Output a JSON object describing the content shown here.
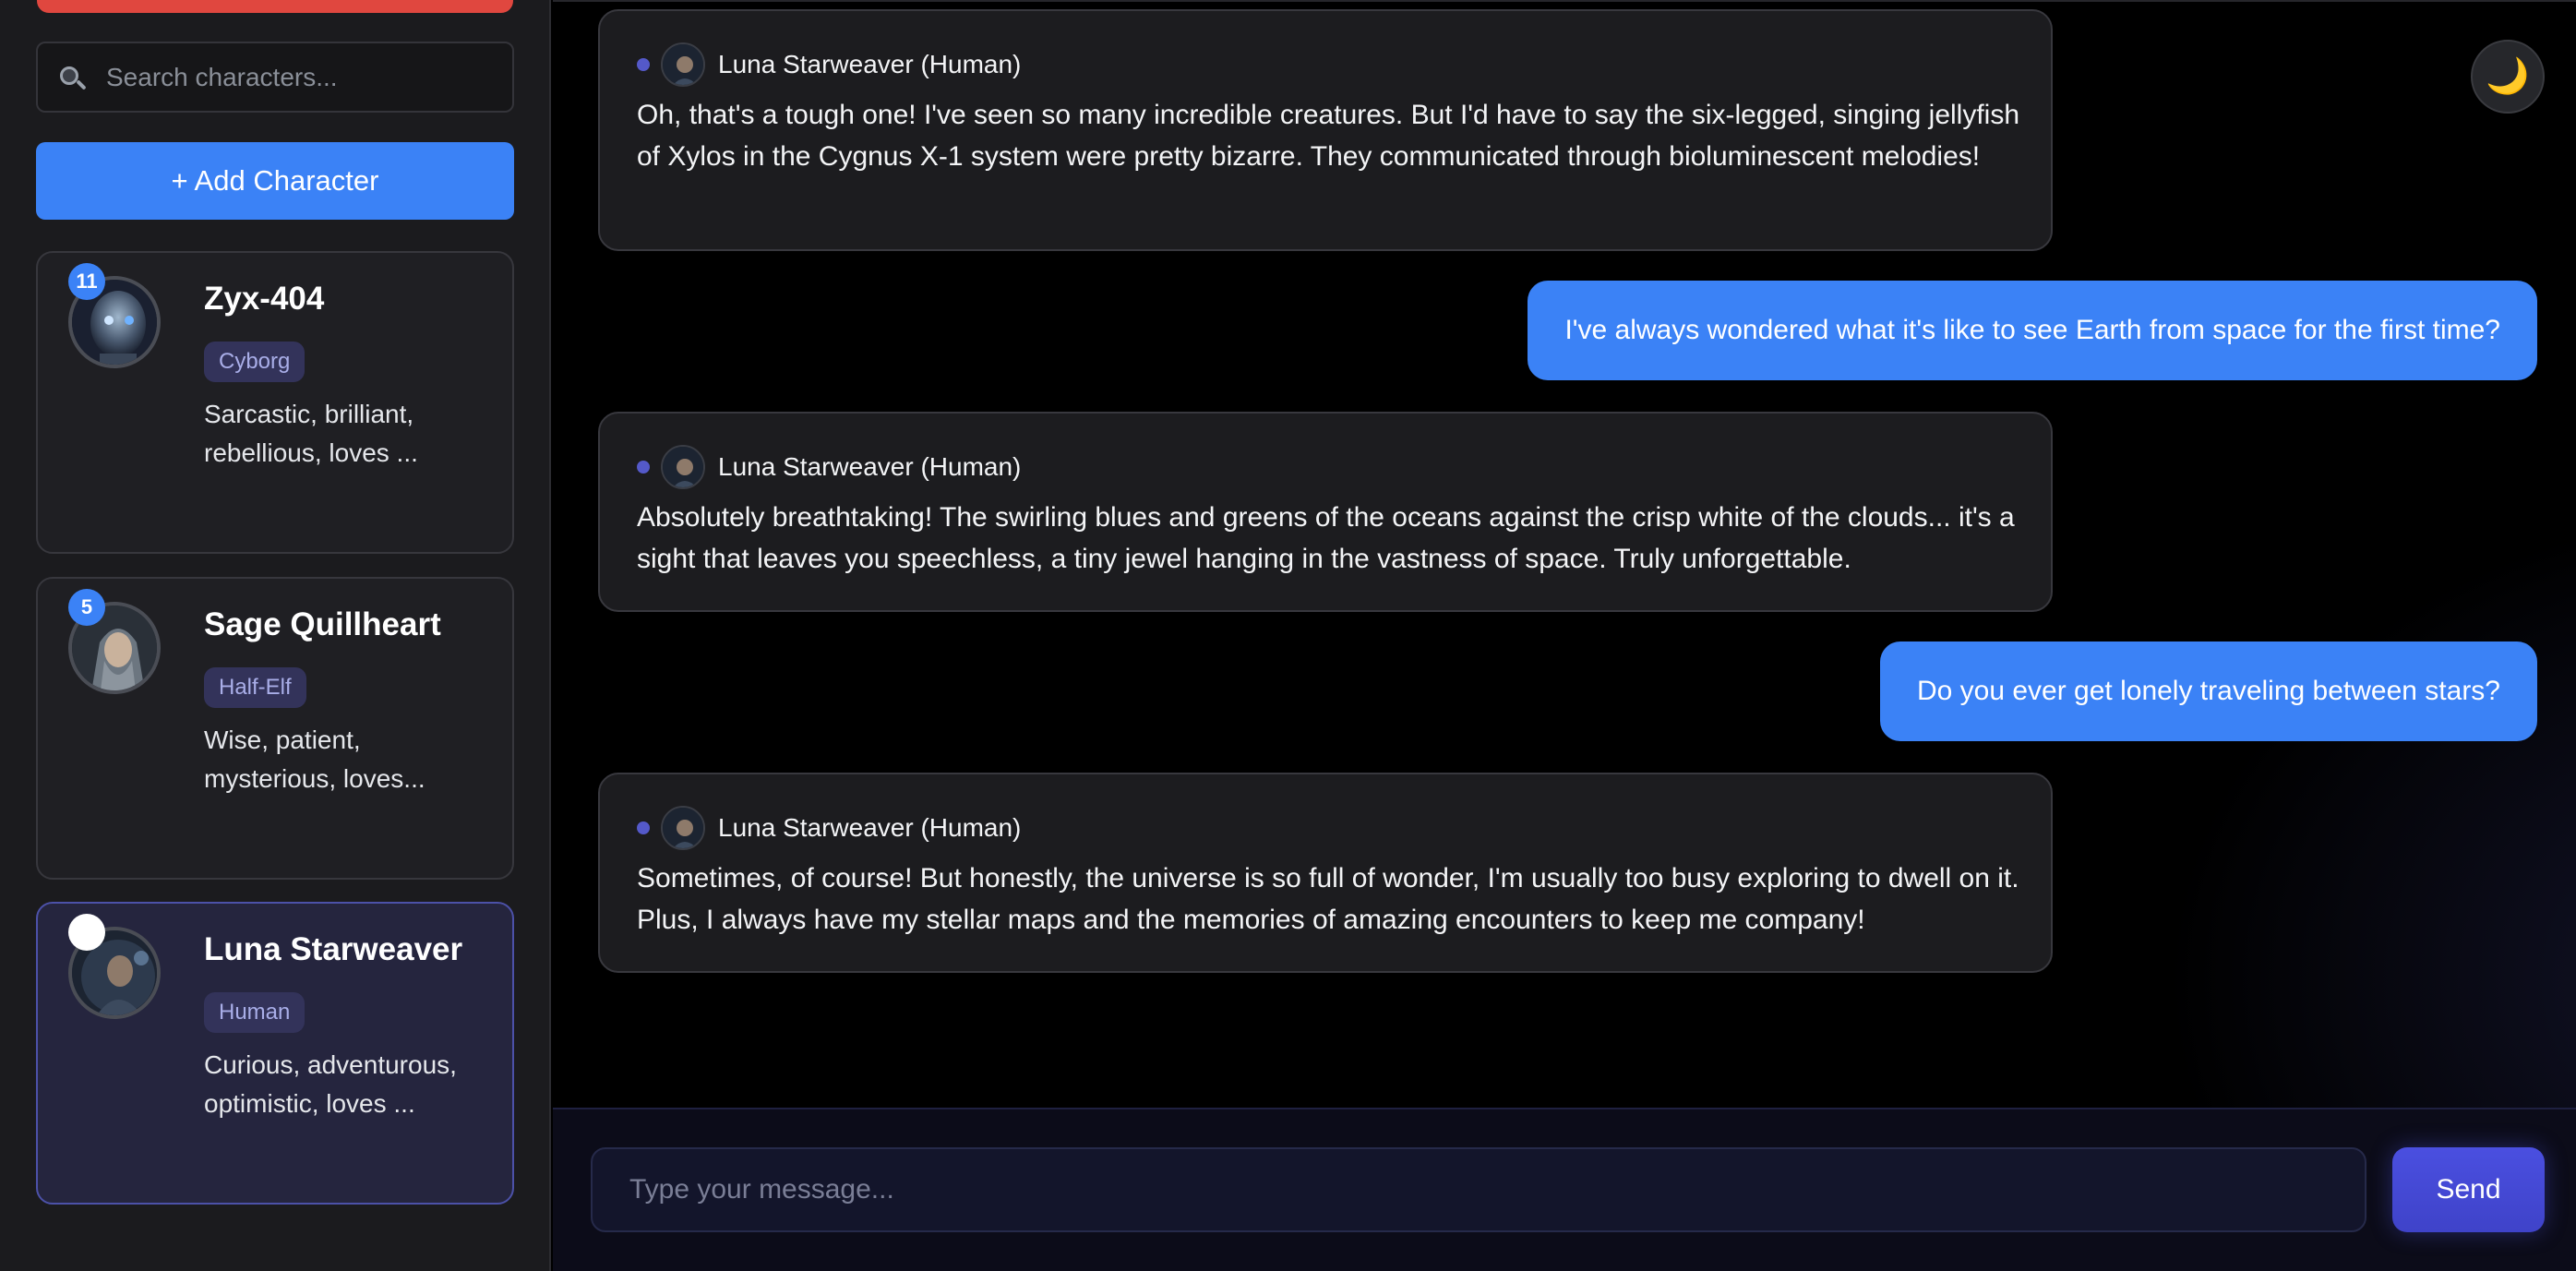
{
  "search": {
    "placeholder": "Search characters..."
  },
  "add_character": {
    "label": "+ Add Character"
  },
  "characters": [
    {
      "name": "Zyx-404",
      "race": "Cyborg",
      "description": "Sarcastic, brilliant, rebellious, loves ...",
      "badge": "11",
      "selected": false,
      "avatar_icon": "cyborg-portrait"
    },
    {
      "name": "Sage Quillheart",
      "race": "Half-Elf",
      "description": "Wise, patient, mysterious, loves...",
      "badge": "5",
      "selected": false,
      "avatar_icon": "half-elf-portrait"
    },
    {
      "name": "Luna Starweaver",
      "race": "Human",
      "description": "Curious, adventurous, optimistic, loves ...",
      "badge": "",
      "selected": true,
      "avatar_icon": "human-portrait"
    }
  ],
  "messages": [
    {
      "role": "ai",
      "author": "Luna Starweaver (Human)",
      "text": "Oh, that's a tough one! I've seen so many incredible creatures. But I'd have to say the six-legged, singing jellyfish of Xylos in the Cygnus X-1 system were pretty bizarre. They communicated through bioluminescent melodies!"
    },
    {
      "role": "user",
      "text": "I've always wondered what it's like to see Earth from space for the first time?"
    },
    {
      "role": "ai",
      "author": "Luna Starweaver (Human)",
      "text": "Absolutely breathtaking! The swirling blues and greens of the oceans against the crisp white of the clouds... it's a sight that leaves you speechless, a tiny jewel hanging in the vastness of space. Truly unforgettable."
    },
    {
      "role": "user",
      "text": "Do you ever get lonely traveling between stars?"
    },
    {
      "role": "ai",
      "author": "Luna Starweaver (Human)",
      "text": "Sometimes, of course! But honestly, the universe is so full of wonder, I'm usually too busy exploring to dwell on it. Plus, I always have my stellar maps and the memories of amazing encounters to keep me company!"
    }
  ],
  "composer": {
    "placeholder": "Type your message...",
    "send_label": "Send"
  },
  "theme_toggle": {
    "icon": "moon-icon",
    "glyph": "🌙"
  },
  "colors": {
    "accent": "#3b82f6",
    "send": "#4549d6",
    "selected_card": "#25253e",
    "alert_strip": "#e0473f"
  }
}
